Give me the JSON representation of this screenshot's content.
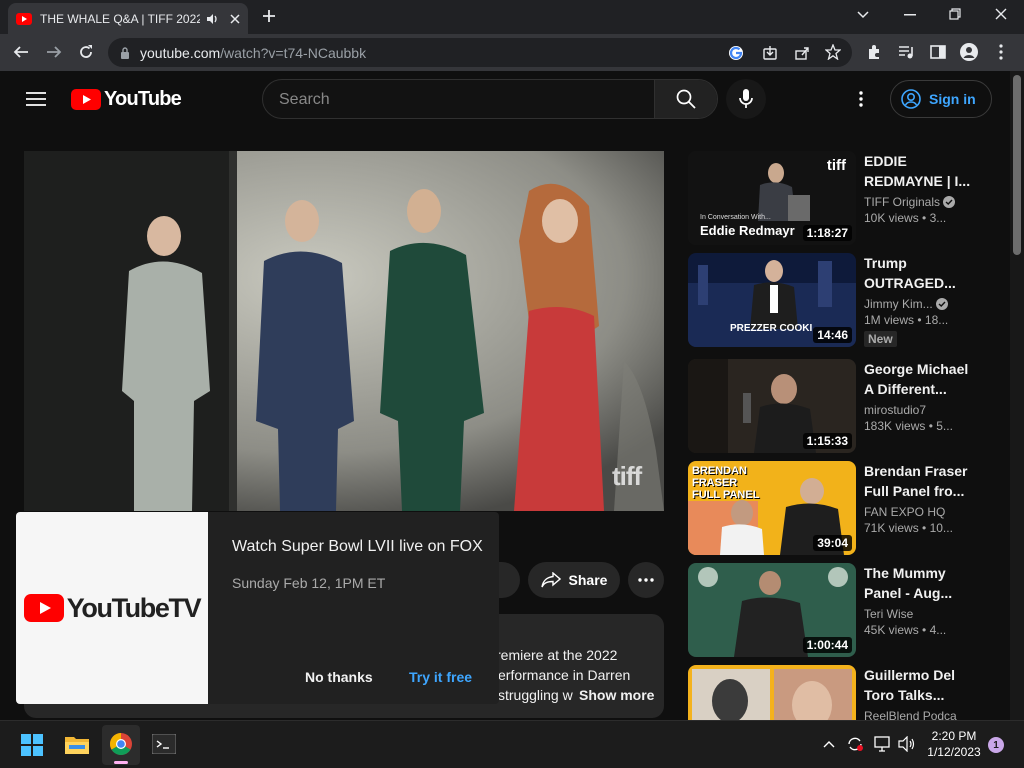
{
  "browser": {
    "tab_title": "THE WHALE Q&A | TIFF 2022",
    "url_host": "youtube.com",
    "url_path": "/watch?v=t74-NCaubbk"
  },
  "youtube": {
    "logo_text": "YouTube",
    "search_placeholder": "Search",
    "signin_label": "Sign in"
  },
  "player": {
    "watermark": "tiff"
  },
  "actions": {
    "share_label": "Share"
  },
  "description": {
    "line1": "remiere at the 2022",
    "line2": "erformance in Darren",
    "line3": "struggling w",
    "show_more": "Show more"
  },
  "popup": {
    "logo_text": "YouTubeTV",
    "title": "Watch Super Bowl LVII live on FOX",
    "subtitle": "Sunday Feb 12, 1PM ET",
    "no_thanks": "No thanks",
    "try_free": "Try it free"
  },
  "recommendations": [
    {
      "title_1": "EDDIE",
      "title_2": "REDMAYNE | I...",
      "channel": "TIFF Originals",
      "verified": true,
      "views": "10K views",
      "age": "• 3...",
      "duration": "1:18:27",
      "thumb_caption": "Eddie Redmayr",
      "thumb_small": "In Conversation With...",
      "thumb_logo": "tiff"
    },
    {
      "title_1": "Trump",
      "title_2": "OUTRAGED...",
      "channel": "Jimmy Kim...",
      "verified": true,
      "views": "1M views",
      "age": "• 18...",
      "badge": "New",
      "duration": "14:46",
      "thumb_caption": "PREZZER COOKI"
    },
    {
      "title_1": "George Michael",
      "title_2": "A Different...",
      "channel": "mirostudio7",
      "verified": false,
      "views": "183K views",
      "age": "• 5...",
      "duration": "1:15:33"
    },
    {
      "title_1": "Brendan Fraser",
      "title_2": "Full Panel fro...",
      "channel": "FAN EXPO HQ",
      "verified": false,
      "views": "71K views",
      "age": "• 10...",
      "duration": "39:04",
      "thumb_caption": "BRENDAN FRASER FULL PANEL"
    },
    {
      "title_1": "The Mummy",
      "title_2": "Panel - Aug...",
      "channel": "Teri Wise",
      "verified": false,
      "views": "45K views",
      "age": "• 4...",
      "duration": "1:00:44"
    },
    {
      "title_1": "Guillermo Del",
      "title_2": "Toro Talks...",
      "channel": "ReelBlend Podca",
      "verified": false,
      "views": "",
      "age": ""
    }
  ],
  "taskbar": {
    "time": "2:20 PM",
    "date": "1/12/2023",
    "notification_count": "1"
  },
  "colors": {
    "youtube_red": "#ff0000",
    "link_blue": "#3ea6ff"
  }
}
